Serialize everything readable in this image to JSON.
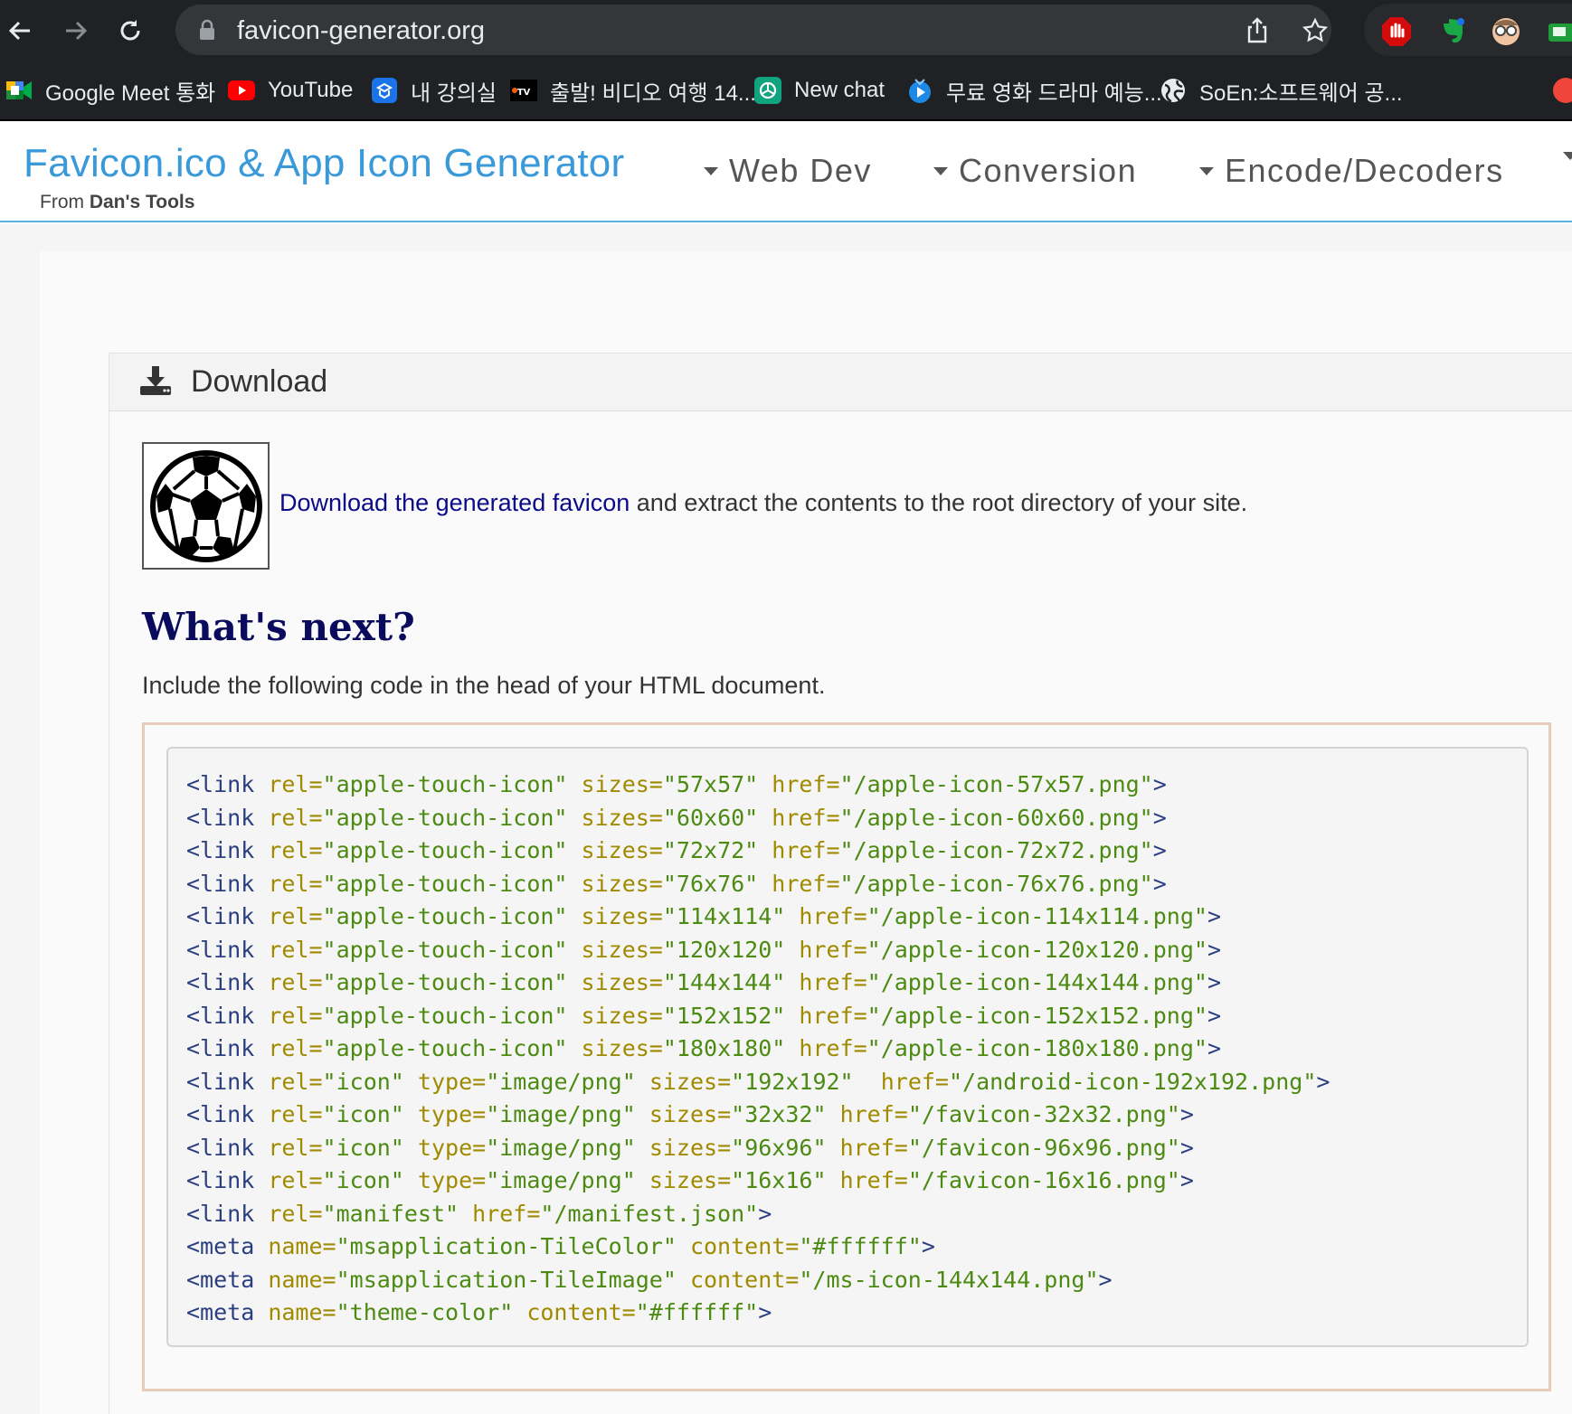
{
  "browser": {
    "url": "favicon-generator.org",
    "bookmarks": [
      {
        "label": "Google Meet 통화",
        "icon": "google-meet-icon"
      },
      {
        "label": "YouTube",
        "icon": "youtube-icon"
      },
      {
        "label": "내 강의실",
        "icon": "classroom-icon"
      },
      {
        "label": "출발! 비디오 여행 14...",
        "icon": "tv-icon"
      },
      {
        "label": "New chat",
        "icon": "chatgpt-icon"
      },
      {
        "label": "무료 영화 드라마 예능...",
        "icon": "play-icon"
      },
      {
        "label": "SoEn:소프트웨어 공...",
        "icon": "globe-icon"
      }
    ]
  },
  "header": {
    "brand": "Favicon.ico & App Icon Generator",
    "byline_prefix": "From ",
    "byline_strong": "Dan's Tools",
    "menu": [
      "Web Dev",
      "Conversion",
      "Encode/Decoders"
    ]
  },
  "download": {
    "title": "Download",
    "link_text": "Download the generated favicon",
    "rest_text": " and extract the contents to the root directory of your site."
  },
  "next": {
    "heading": "What's next?",
    "instruction": "Include the following code in the head of your HTML document."
  },
  "code_lines": [
    {
      "tag": "<link",
      "attrs": [
        [
          "rel",
          "\"apple-touch-icon\""
        ],
        [
          "sizes",
          "\"57x57\""
        ],
        [
          "href",
          "\"/apple-icon-57x57.png\""
        ]
      ]
    },
    {
      "tag": "<link",
      "attrs": [
        [
          "rel",
          "\"apple-touch-icon\""
        ],
        [
          "sizes",
          "\"60x60\""
        ],
        [
          "href",
          "\"/apple-icon-60x60.png\""
        ]
      ]
    },
    {
      "tag": "<link",
      "attrs": [
        [
          "rel",
          "\"apple-touch-icon\""
        ],
        [
          "sizes",
          "\"72x72\""
        ],
        [
          "href",
          "\"/apple-icon-72x72.png\""
        ]
      ]
    },
    {
      "tag": "<link",
      "attrs": [
        [
          "rel",
          "\"apple-touch-icon\""
        ],
        [
          "sizes",
          "\"76x76\""
        ],
        [
          "href",
          "\"/apple-icon-76x76.png\""
        ]
      ]
    },
    {
      "tag": "<link",
      "attrs": [
        [
          "rel",
          "\"apple-touch-icon\""
        ],
        [
          "sizes",
          "\"114x114\""
        ],
        [
          "href",
          "\"/apple-icon-114x114.png\""
        ]
      ]
    },
    {
      "tag": "<link",
      "attrs": [
        [
          "rel",
          "\"apple-touch-icon\""
        ],
        [
          "sizes",
          "\"120x120\""
        ],
        [
          "href",
          "\"/apple-icon-120x120.png\""
        ]
      ]
    },
    {
      "tag": "<link",
      "attrs": [
        [
          "rel",
          "\"apple-touch-icon\""
        ],
        [
          "sizes",
          "\"144x144\""
        ],
        [
          "href",
          "\"/apple-icon-144x144.png\""
        ]
      ]
    },
    {
      "tag": "<link",
      "attrs": [
        [
          "rel",
          "\"apple-touch-icon\""
        ],
        [
          "sizes",
          "\"152x152\""
        ],
        [
          "href",
          "\"/apple-icon-152x152.png\""
        ]
      ]
    },
    {
      "tag": "<link",
      "attrs": [
        [
          "rel",
          "\"apple-touch-icon\""
        ],
        [
          "sizes",
          "\"180x180\""
        ],
        [
          "href",
          "\"/apple-icon-180x180.png\""
        ]
      ]
    },
    {
      "tag": "<link",
      "attrs": [
        [
          "rel",
          "\"icon\""
        ],
        [
          "type",
          "\"image/png\""
        ],
        [
          "sizes",
          "\"192x192\" "
        ],
        [
          "href",
          "\"/android-icon-192x192.png\""
        ]
      ]
    },
    {
      "tag": "<link",
      "attrs": [
        [
          "rel",
          "\"icon\""
        ],
        [
          "type",
          "\"image/png\""
        ],
        [
          "sizes",
          "\"32x32\""
        ],
        [
          "href",
          "\"/favicon-32x32.png\""
        ]
      ]
    },
    {
      "tag": "<link",
      "attrs": [
        [
          "rel",
          "\"icon\""
        ],
        [
          "type",
          "\"image/png\""
        ],
        [
          "sizes",
          "\"96x96\""
        ],
        [
          "href",
          "\"/favicon-96x96.png\""
        ]
      ]
    },
    {
      "tag": "<link",
      "attrs": [
        [
          "rel",
          "\"icon\""
        ],
        [
          "type",
          "\"image/png\""
        ],
        [
          "sizes",
          "\"16x16\""
        ],
        [
          "href",
          "\"/favicon-16x16.png\""
        ]
      ]
    },
    {
      "tag": "<link",
      "attrs": [
        [
          "rel",
          "\"manifest\""
        ],
        [
          "href",
          "\"/manifest.json\""
        ]
      ]
    },
    {
      "tag": "<meta",
      "attrs": [
        [
          "name",
          "\"msapplication-TileColor\""
        ],
        [
          "content",
          "\"#ffffff\""
        ]
      ]
    },
    {
      "tag": "<meta",
      "attrs": [
        [
          "name",
          "\"msapplication-TileImage\""
        ],
        [
          "content",
          "\"/ms-icon-144x144.png\""
        ]
      ]
    },
    {
      "tag": "<meta",
      "attrs": [
        [
          "name",
          "\"theme-color\""
        ],
        [
          "content",
          "\"#ffffff\""
        ]
      ]
    }
  ],
  "colors": {
    "brand": "#3a9ad9",
    "link": "#0b0b8a",
    "heading": "#0b0b5e",
    "code_tag": "#2b3f80",
    "code_attr": "#a08a00",
    "code_value": "#4c8a12"
  }
}
